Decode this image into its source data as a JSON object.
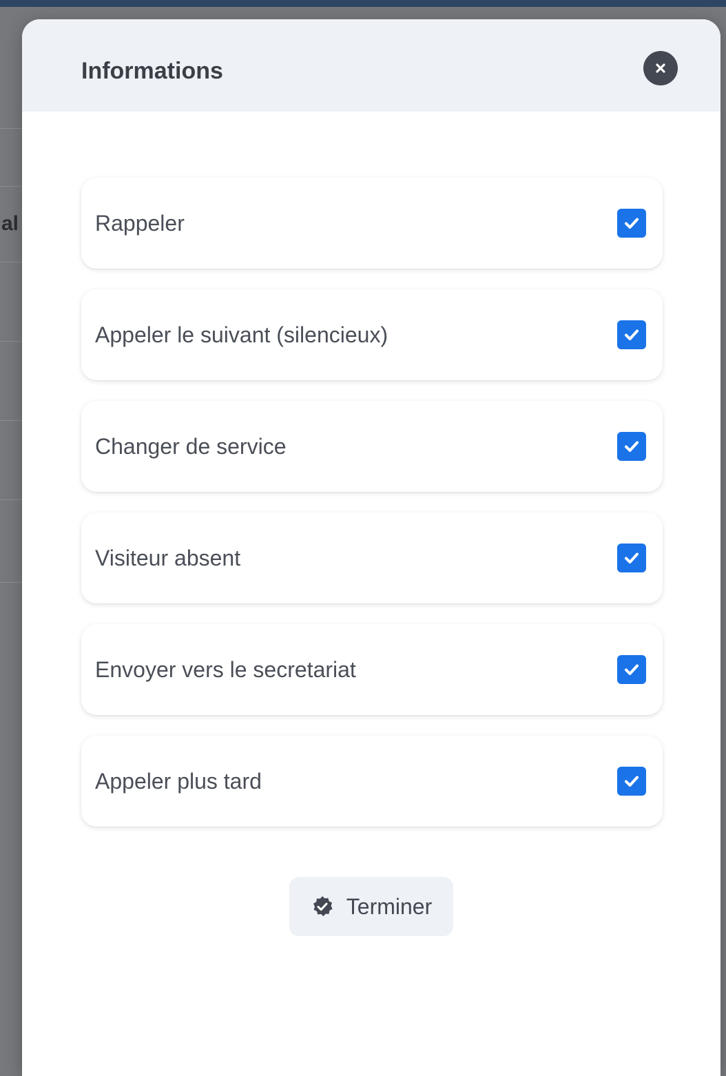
{
  "background": {
    "partial_text": "al"
  },
  "modal": {
    "title": "Informations",
    "close_icon": "close-icon",
    "options": [
      {
        "label": "Rappeler",
        "checked": true
      },
      {
        "label": "Appeler le suivant (silencieux)",
        "checked": true
      },
      {
        "label": "Changer de service",
        "checked": true
      },
      {
        "label": "Visiteur absent",
        "checked": true
      },
      {
        "label": "Envoyer vers le secretariat",
        "checked": true
      },
      {
        "label": "Appeler plus tard",
        "checked": true
      }
    ],
    "finish_button": {
      "label": "Terminer",
      "icon": "check-badge-icon"
    }
  },
  "colors": {
    "checkbox": "#1a73e8",
    "header_bg": "#eef1f6",
    "title_text": "#3b3f47"
  }
}
